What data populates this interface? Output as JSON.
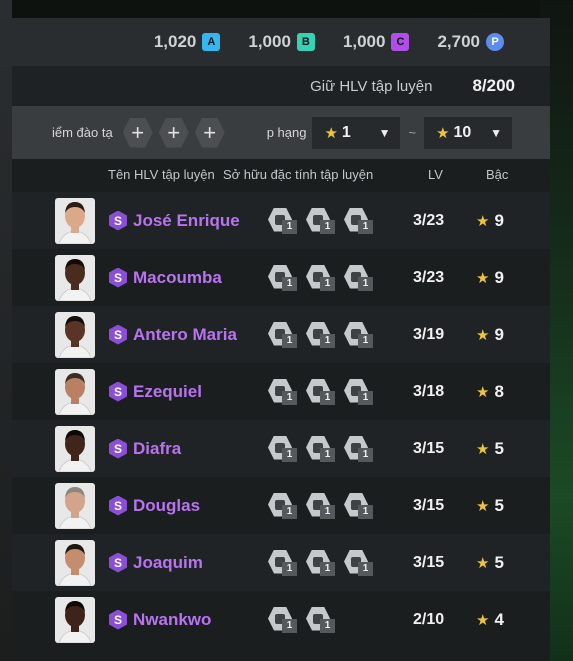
{
  "currencies": [
    {
      "value": "1,020",
      "letter": "A",
      "color": "#35b6f0"
    },
    {
      "value": "1,000",
      "letter": "B",
      "color": "#37d2b4"
    },
    {
      "value": "1,000",
      "letter": "C",
      "color": "#b04fe8"
    },
    {
      "value": "2,700",
      "letter": "P",
      "color": "#5b8cf0"
    }
  ],
  "count": {
    "label": "Giữ HLV tập luyện",
    "value": "8/200"
  },
  "filters": {
    "training_points_label": "iểm đào tạ",
    "rank_label": "p hạng",
    "rank_from": "1",
    "separator": "~",
    "rank_to": "10"
  },
  "headers": {
    "name": "Tên HLV tập luyện",
    "traits": "Sở hữu đặc tính tập luyện",
    "lv": "LV",
    "grade": "Bậc"
  },
  "coaches": [
    {
      "badge": "S",
      "name": "José Enrique",
      "traits": [
        "1",
        "1",
        "1"
      ],
      "lv": "3/23",
      "grade": "9",
      "skin": "#d9a98a",
      "hair": "#2b1c14"
    },
    {
      "badge": "S",
      "name": "Macoumba",
      "traits": [
        "1",
        "1",
        "1"
      ],
      "lv": "3/23",
      "grade": "9",
      "skin": "#4a2c1f",
      "hair": "#120b07"
    },
    {
      "badge": "S",
      "name": "Antero Maria",
      "traits": [
        "1",
        "1",
        "1"
      ],
      "lv": "3/19",
      "grade": "9",
      "skin": "#5a3424",
      "hair": "#140c08"
    },
    {
      "badge": "S",
      "name": "Ezequiel",
      "traits": [
        "1",
        "1",
        "1"
      ],
      "lv": "3/18",
      "grade": "8",
      "skin": "#b98064",
      "hair": "#3b2e28"
    },
    {
      "badge": "S",
      "name": "Diafra",
      "traits": [
        "1",
        "1",
        "1"
      ],
      "lv": "3/15",
      "grade": "5",
      "skin": "#3f251a",
      "hair": "#0f0906"
    },
    {
      "badge": "S",
      "name": "Douglas",
      "traits": [
        "1",
        "1",
        "1"
      ],
      "lv": "3/15",
      "grade": "5",
      "skin": "#d3a48c",
      "hair": "#8d8781"
    },
    {
      "badge": "S",
      "name": "Joaquim",
      "traits": [
        "1",
        "1",
        "1"
      ],
      "lv": "3/15",
      "grade": "5",
      "skin": "#c48e6e",
      "hair": "#1e1612"
    },
    {
      "badge": "S",
      "name": "Nwankwo",
      "traits": [
        "1",
        "1"
      ],
      "lv": "2/10",
      "grade": "4",
      "skin": "#3c2418",
      "hair": "#100a07"
    }
  ]
}
